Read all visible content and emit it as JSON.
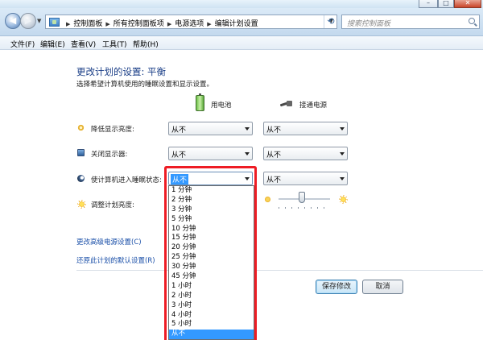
{
  "window": {
    "buttons": {
      "minimize": "–",
      "maximize": "□",
      "close": "✕"
    }
  },
  "nav": {
    "back_icon": "back-arrow-icon",
    "forward_icon": "forward-arrow-icon",
    "breadcrumbs": [
      "控制面板",
      "所有控制面板项",
      "电源选项",
      "编辑计划设置"
    ],
    "search_placeholder": "搜索控制面板"
  },
  "menu": [
    "文件(F)",
    "编辑(E)",
    "查看(V)",
    "工具(T)",
    "帮助(H)"
  ],
  "page": {
    "title": "更改计划的设置: 平衡",
    "subtitle": "选择希望计算机使用的睡眠设置和显示设置。"
  },
  "columns": {
    "battery": "用电池",
    "plugged": "接通电源"
  },
  "rows": [
    {
      "label": "降低显示亮度:",
      "battery": "从不",
      "plugged": "从不"
    },
    {
      "label": "关闭显示器:",
      "battery": "从不",
      "plugged": "从不"
    },
    {
      "label": "使计算机进入睡眠状态:",
      "battery": "从不",
      "plugged": "从不"
    },
    {
      "label": "调整计划亮度:"
    }
  ],
  "brightness": {
    "plugged_level": 0.45
  },
  "links": {
    "advanced": "更改高级电源设置(C)",
    "restore": "还原此计划的默认设置(R)"
  },
  "buttons": {
    "save": "保存修改",
    "cancel": "取消"
  },
  "dropdown": {
    "options": [
      "1 分钟",
      "2 分钟",
      "3 分钟",
      "5 分钟",
      "10 分钟",
      "15 分钟",
      "20 分钟",
      "25 分钟",
      "30 分钟",
      "45 分钟",
      "1 小时",
      "2 小时",
      "3 小时",
      "4 小时",
      "5 小时",
      "从不"
    ],
    "selected": "从不"
  },
  "colors": {
    "link": "#1a4fa8",
    "title": "#1a3e87",
    "selection": "#3399ff",
    "highlight": "#ee1c24"
  }
}
